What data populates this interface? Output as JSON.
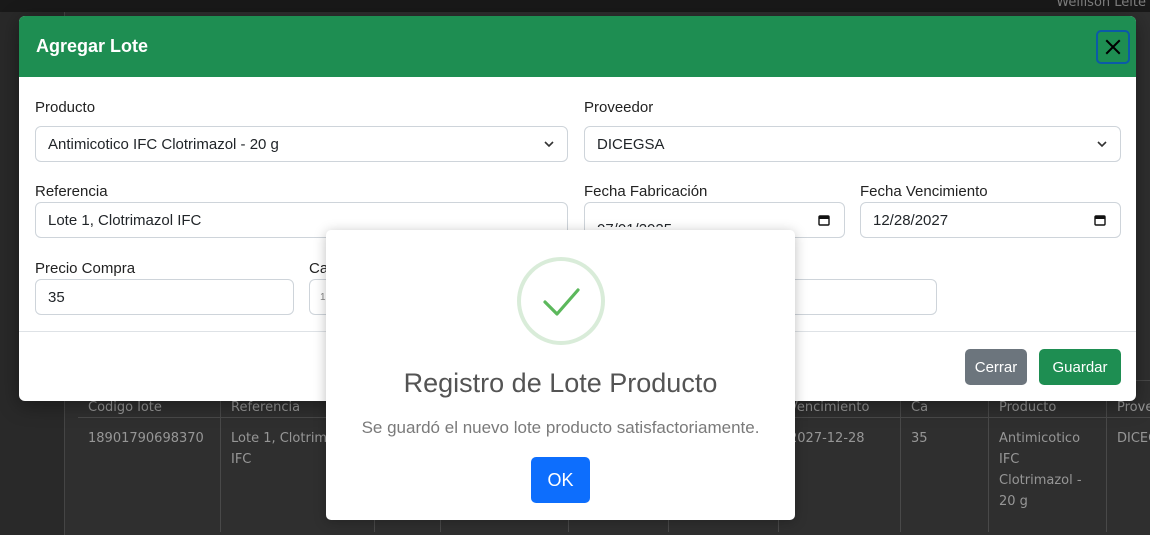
{
  "background": {
    "user_label": "Wellison Leite",
    "table": {
      "headers": [
        "Codigo lote",
        "Referencia",
        "",
        "",
        "",
        "",
        "Vencimiento",
        "Ca",
        "Producto",
        "Proveedor"
      ],
      "row": [
        "18901790698370",
        "Lote 1, Clotrimazol IFC",
        "",
        "",
        "",
        "",
        "2027-12-28",
        "35",
        "Antimicotico IFC Clotrimazol - 20 g",
        "DICEGSA"
      ]
    }
  },
  "modal": {
    "title": "Agregar Lote",
    "close_icon": "close-icon",
    "fields": {
      "producto_label": "Producto",
      "producto_value": "Antimicotico IFC Clotrimazol - 20 g",
      "proveedor_label": "Proveedor",
      "proveedor_value": "DICEGSA",
      "referencia_label": "Referencia",
      "referencia_value": "Lote 1, Clotrimazol IFC",
      "fecha_fabricacion_label": "Fecha Fabricación",
      "fecha_fabricacion_value": "07/01/2025",
      "fecha_vencimiento_label": "Fecha Vencimiento",
      "fecha_vencimiento_value": "12/28/2027",
      "precio_compra_label": "Precio Compra",
      "precio_compra_value": "35",
      "cantidad_label": "Ca",
      "cantidad_value": "1"
    },
    "buttons": {
      "cerrar": "Cerrar",
      "guardar": "Guardar"
    }
  },
  "alert": {
    "icon": "success-check-icon",
    "title": "Registro de Lote Producto",
    "text": "Se guardó el nuevo lote producto satisfactoriamente.",
    "ok_label": "OK"
  },
  "colors": {
    "header_green": "#1e8e52",
    "ok_blue": "#0d6efd",
    "cerrar_gray": "#6c757d",
    "success_check": "#5cb85c"
  }
}
